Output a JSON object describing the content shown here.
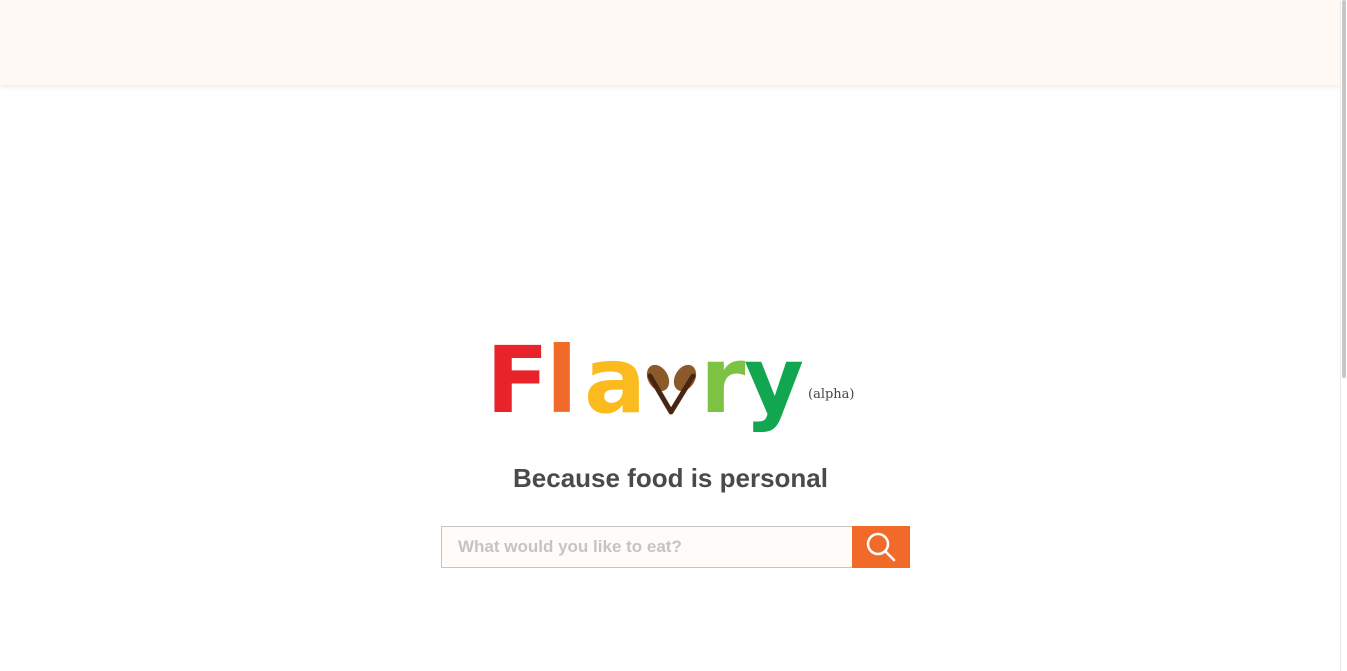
{
  "header": {},
  "brand": {
    "letters": [
      "F",
      "l",
      "a",
      "v",
      "r",
      "y"
    ],
    "suffix": "(alpha)",
    "colors": {
      "F": "#e8232a",
      "l": "#f26a2a",
      "a": "#fbbb1e",
      "v_leaf": "#8b5a2b",
      "v_stem": "#4a2612",
      "r": "#7cc243",
      "y": "#12a650"
    }
  },
  "tagline": "Because food is personal",
  "search": {
    "placeholder": "What would you like to eat?",
    "value": "",
    "button_icon": "search-icon",
    "button_color": "#f26a2a"
  }
}
